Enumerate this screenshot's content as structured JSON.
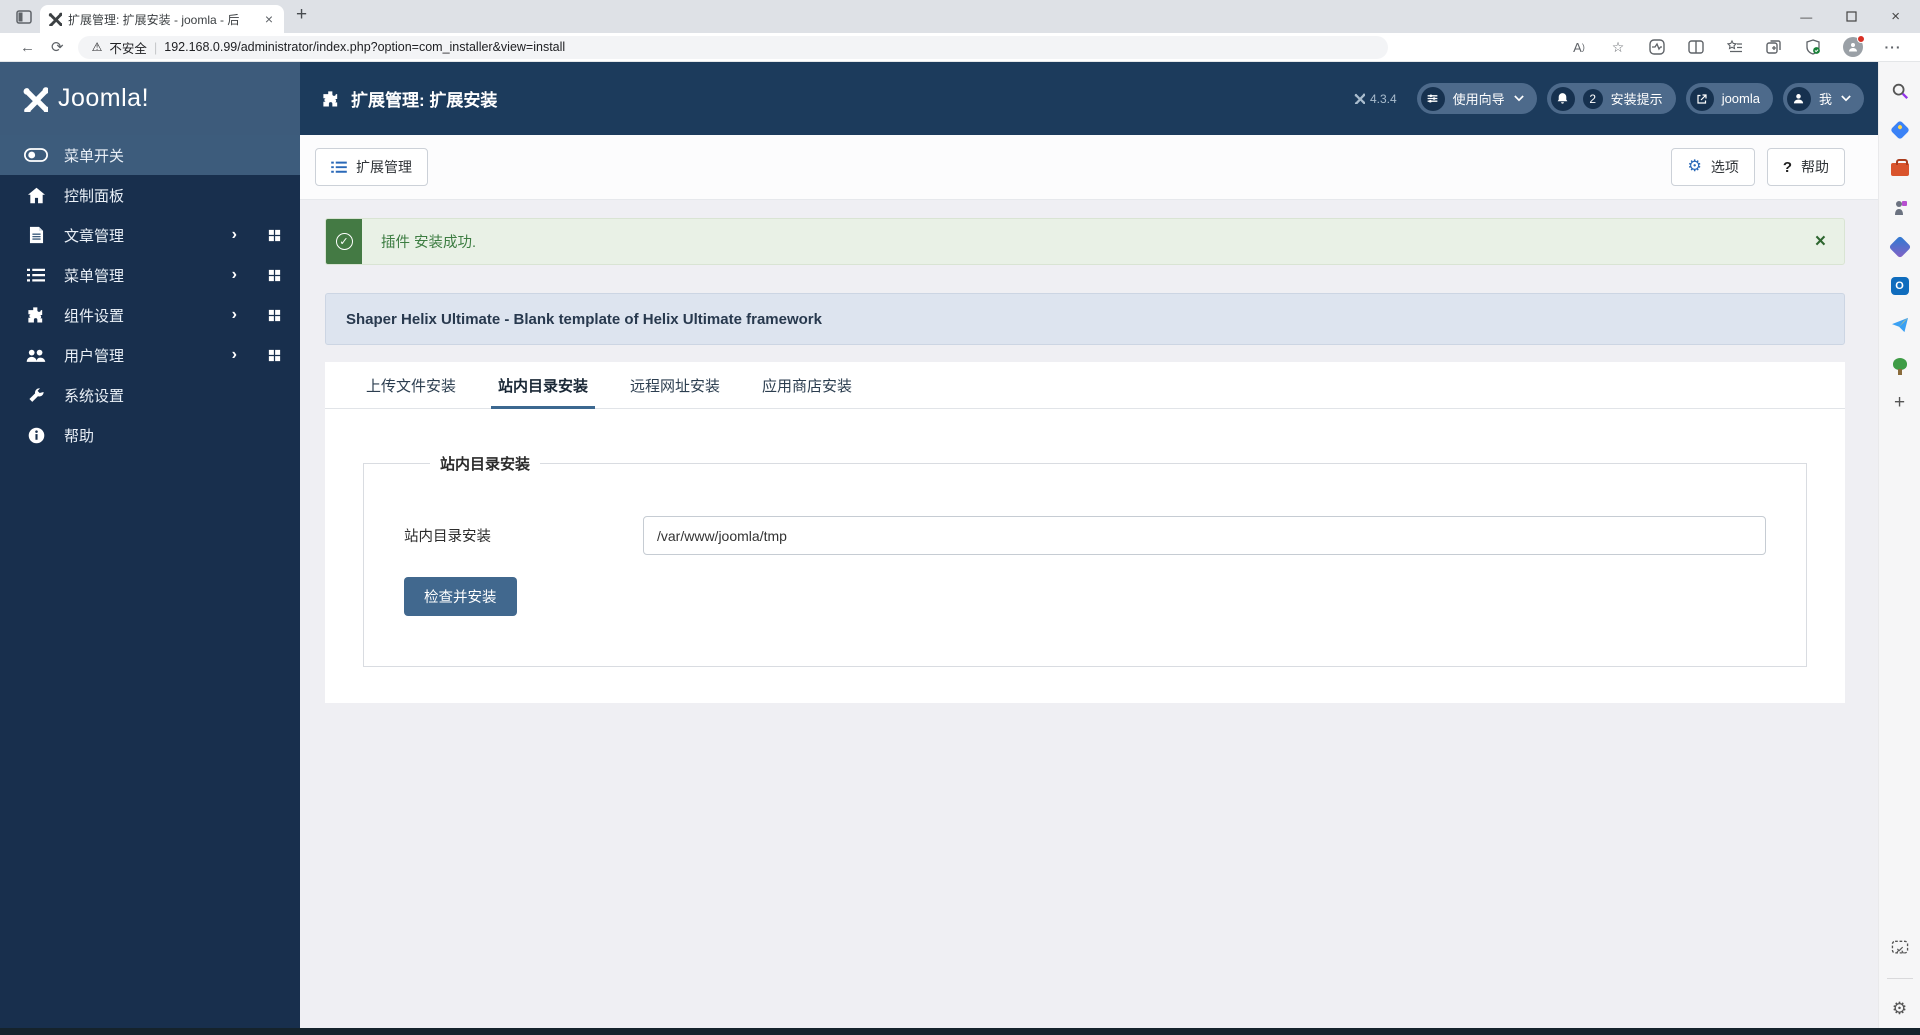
{
  "colors": {
    "navy": "#1c3b5c",
    "logo-band": "#3d5b7b",
    "sidebar": "#182f4d",
    "sidebar-active": "#3d5c7c",
    "pill": "#4d6a8b",
    "pill-dark": "#16314f",
    "accent-blue": "#2a69b8",
    "btn-blue": "#41688e",
    "alert-green": "#447a44",
    "alert-bg": "#e9f1e6",
    "alert-text": "#3d7d42",
    "panel-bg": "#dde4ef",
    "panel-border": "#ccd5e3",
    "tab-underline": "#3c6890",
    "content-bg": "#efeff3"
  },
  "browser": {
    "tab_title": "扩展管理: 扩展安装 - joomla - 后",
    "security_label": "不安全",
    "url": "192.168.0.99/administrator/index.php?option=com_installer&view=install"
  },
  "header": {
    "logo_text": "Joomla!",
    "page_title": "扩展管理: 扩展安装",
    "version": "4.3.4",
    "guide_label": "使用向导",
    "notice_count": "2",
    "notice_label": "安装提示",
    "site_label": "joomla",
    "me_label": "我"
  },
  "sidebar": {
    "items": [
      {
        "label": "菜单开关"
      },
      {
        "label": "控制面板"
      },
      {
        "label": "文章管理"
      },
      {
        "label": "菜单管理"
      },
      {
        "label": "组件设置"
      },
      {
        "label": "用户管理"
      },
      {
        "label": "系统设置"
      },
      {
        "label": "帮助"
      }
    ]
  },
  "toolbar": {
    "manage_label": "扩展管理",
    "options_label": "选项",
    "help_label": "帮助"
  },
  "main": {
    "alert_message": "插件 安装成功.",
    "panel_title": "Shaper Helix Ultimate - Blank template of Helix Ultimate framework",
    "tabs": [
      {
        "label": "上传文件安装"
      },
      {
        "label": "站内目录安装"
      },
      {
        "label": "远程网址安装"
      },
      {
        "label": "应用商店安装"
      }
    ],
    "active_tab": "站内目录安装",
    "form": {
      "legend": "站内目录安装",
      "field_label": "站内目录安装",
      "field_value": "/var/www/joomla/tmp",
      "submit_label": "检查并安装"
    }
  }
}
